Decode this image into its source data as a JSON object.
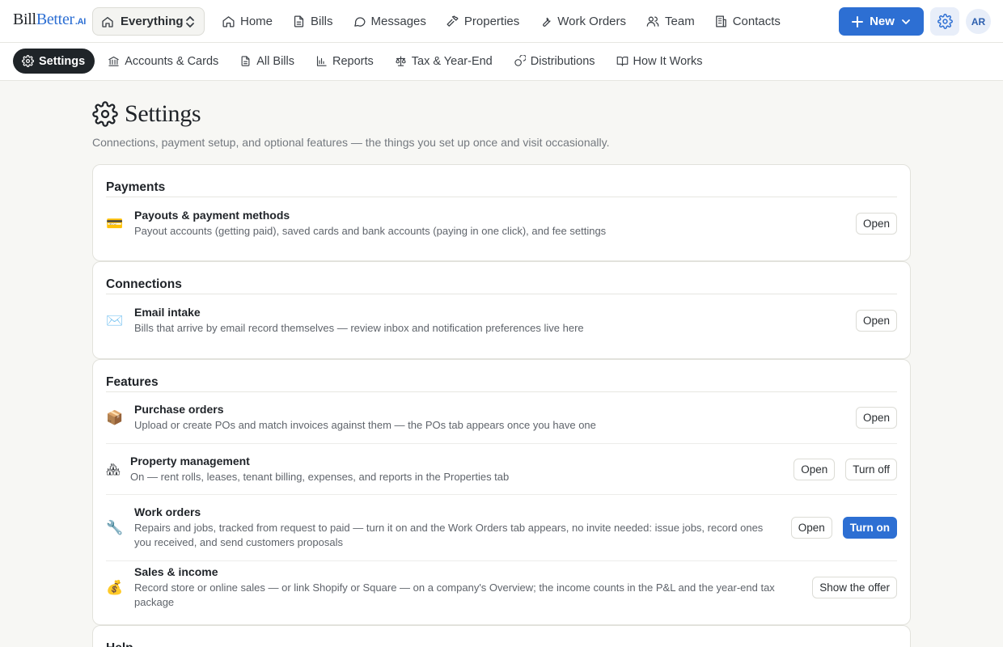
{
  "brand": {
    "part1": "Bill",
    "part2": "Better",
    "suffix": ".AI"
  },
  "scope": {
    "label": "Everything"
  },
  "topnav": [
    {
      "label": "Home",
      "icon": "home-icon"
    },
    {
      "label": "Bills",
      "icon": "document-icon"
    },
    {
      "label": "Messages",
      "icon": "chat-bubble-icon"
    },
    {
      "label": "Properties",
      "icon": "hammer-icon"
    },
    {
      "label": "Work Orders",
      "icon": "wrench-icon"
    },
    {
      "label": "Team",
      "icon": "users-icon"
    },
    {
      "label": "Contacts",
      "icon": "building-icon"
    }
  ],
  "new_button": {
    "label": "New"
  },
  "avatar": {
    "initials": "AR"
  },
  "subnav": [
    {
      "label": "Settings",
      "icon": "gear-icon",
      "active": true
    },
    {
      "label": "Accounts & Cards",
      "icon": "bank-icon"
    },
    {
      "label": "All Bills",
      "icon": "document-icon"
    },
    {
      "label": "Reports",
      "icon": "bar-chart-icon"
    },
    {
      "label": "Tax & Year-End",
      "icon": "scale-icon"
    },
    {
      "label": "Distributions",
      "icon": "coins-icon"
    },
    {
      "label": "How It Works",
      "icon": "book-icon"
    }
  ],
  "page": {
    "title": "Settings",
    "subtitle": "Connections, payment setup, and optional features — the things you set up once and visit occasionally."
  },
  "sections": {
    "payments": {
      "title": "Payments",
      "rows": [
        {
          "emoji": "💳",
          "title": "Payouts & payment methods",
          "desc": "Payout accounts (getting paid), saved cards and bank accounts (paying in one click), and fee settings",
          "open": "Open"
        }
      ]
    },
    "connections": {
      "title": "Connections",
      "rows": [
        {
          "emoji": "✉️",
          "title": "Email intake",
          "desc": "Bills that arrive by email record themselves — review inbox and notification preferences live here",
          "open": "Open"
        }
      ]
    },
    "features": {
      "title": "Features",
      "rows": [
        {
          "emoji": "📦",
          "title": "Purchase orders",
          "desc": "Upload or create POs and match invoices against them — the POs tab appears once you have one",
          "open": "Open"
        },
        {
          "emoji": "🏘",
          "title": "Property management",
          "desc": "On — rent rolls, leases, tenant billing, expenses, and reports in the Properties tab",
          "open": "Open",
          "toggle": "Turn off"
        },
        {
          "emoji": "🔧",
          "title": "Work orders",
          "desc": "Repairs and jobs, tracked from request to paid — turn it on and the Work Orders tab appears, no invite needed: issue jobs, record ones you received, and send customers proposals",
          "open": "Open",
          "toggle": "Turn on"
        },
        {
          "emoji": "💰",
          "title": "Sales & income",
          "desc": "Record store or online sales — or link Shopify or Square — on a company's Overview; the income counts in the P&L and the year-end tax package",
          "offer": "Show the offer"
        }
      ]
    },
    "help": {
      "title": "Help"
    }
  }
}
